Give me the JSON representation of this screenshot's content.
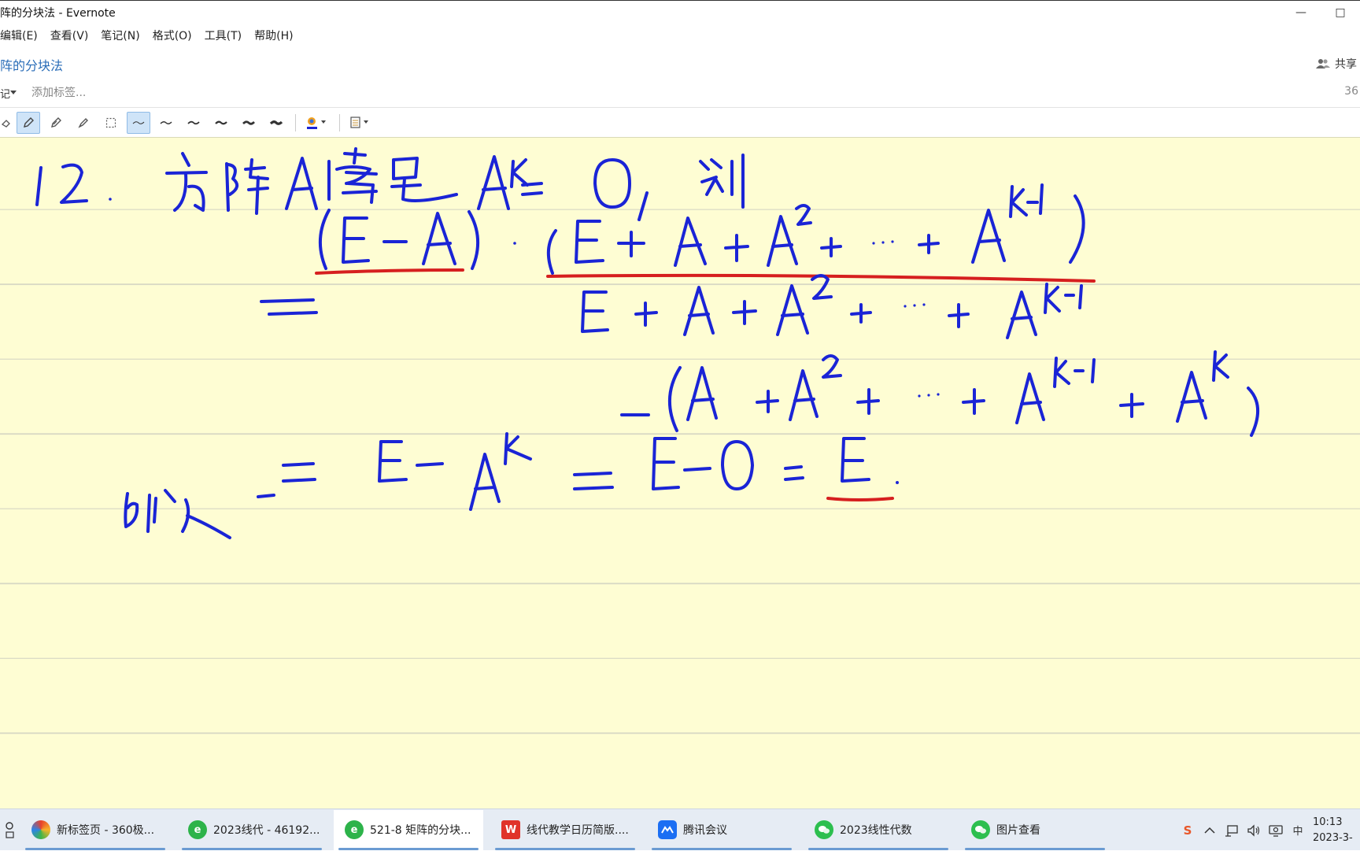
{
  "window": {
    "title": "阵的分块法 - Evernote",
    "minimize_glyph": "—",
    "maximize_glyph": "□"
  },
  "menu": [
    "编辑(E)",
    "查看(V)",
    "笔记(N)",
    "格式(O)",
    "工具(T)",
    "帮助(H)"
  ],
  "note": {
    "title": "阵的分块法",
    "share_label": "共享",
    "tag_placeholder": "添加标签...",
    "size_indicator": "36",
    "notebook_glyph": "记"
  },
  "ink_toolbar": {
    "tools": [
      "lasso-eraser-icon",
      "pen-icon",
      "highlighter-icon",
      "eraser-icon",
      "selection-icon"
    ],
    "active_tool": "pen-icon",
    "stroke_widths": [
      1,
      2,
      3,
      4,
      5,
      6
    ],
    "active_stroke": 1,
    "pen_color": "#1a24d6",
    "highlight_color": "#d61f1f"
  },
  "canvas": {
    "paper_color": "#fefdd3",
    "rule_color": "#d8d8c4"
  },
  "taskbar": {
    "items": [
      {
        "label": "新标签页 - 360极...",
        "icon": "360-browser-icon",
        "color": "#e8412c"
      },
      {
        "label": "2023线代 - 46192...",
        "icon": "evernote-icon",
        "color": "#2db34a"
      },
      {
        "label": "521-8 矩阵的分块...",
        "icon": "evernote-icon",
        "color": "#2db34a",
        "active": true
      },
      {
        "label": "线代教学日历简版....",
        "icon": "wps-icon",
        "color": "#e0332a"
      },
      {
        "label": "腾讯会议",
        "icon": "tencent-meeting-icon",
        "color": "#1b6ef3"
      },
      {
        "label": "2023线性代数",
        "icon": "wechat-icon",
        "color": "#2dbf4f"
      },
      {
        "label": "图片查看",
        "icon": "wechat-icon",
        "color": "#2dbf4f"
      }
    ],
    "tray_icons": [
      "sogou-ime-icon",
      "chevron-up-icon",
      "network-icon",
      "volume-icon",
      "monitor-icon",
      "ime-zh-icon"
    ],
    "ime_label": "中",
    "sogou_label": "S",
    "clock_time": "10:13",
    "clock_date": "2023-3-"
  }
}
